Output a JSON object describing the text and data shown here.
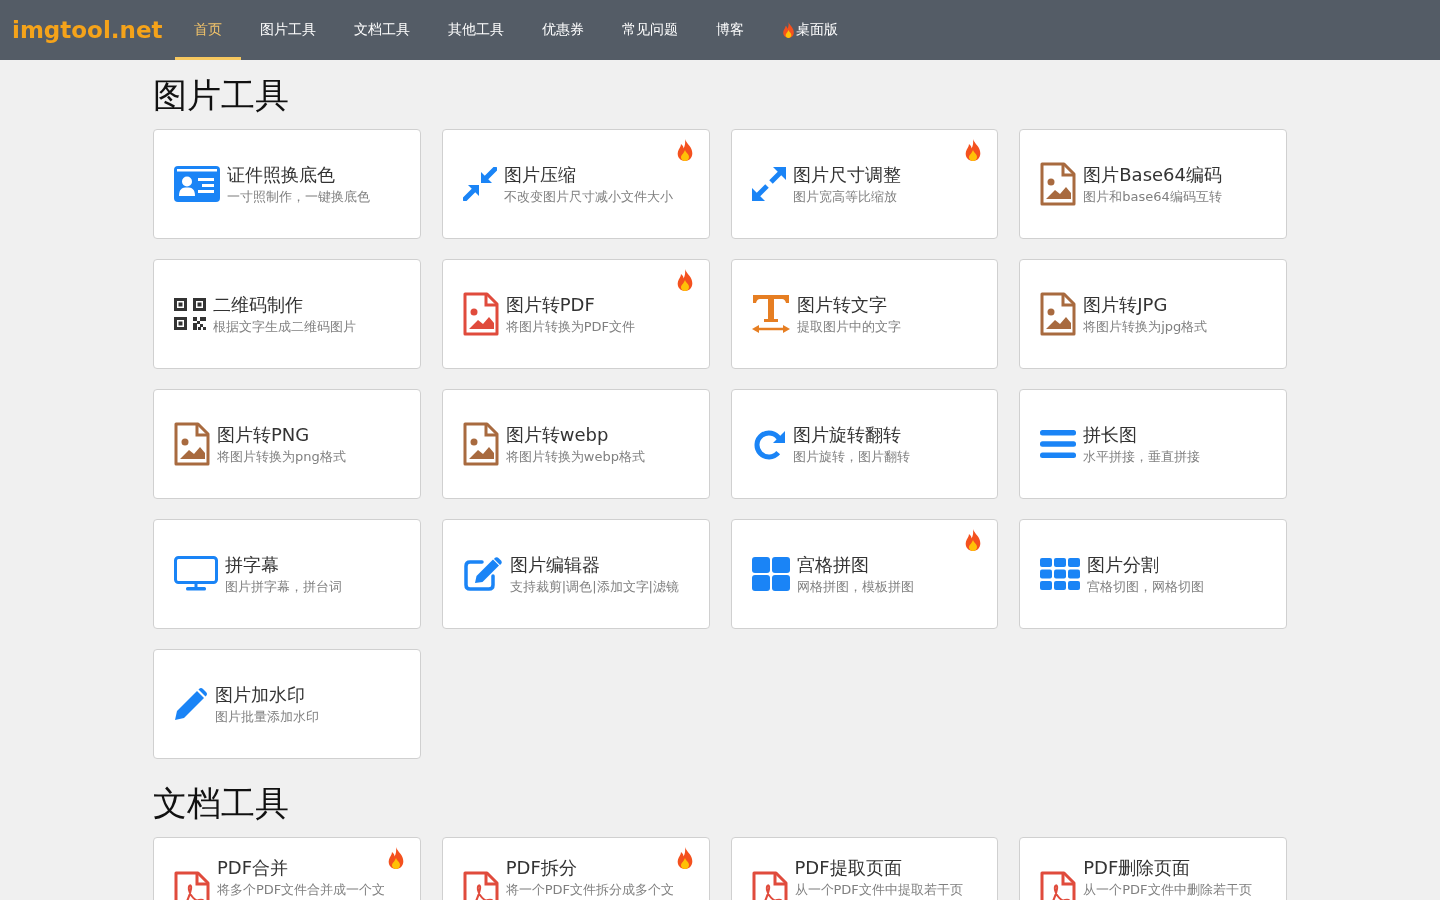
{
  "header": {
    "logo": "imgtool.net",
    "nav": [
      {
        "label": "首页",
        "selected": true,
        "hot": false
      },
      {
        "label": "图片工具",
        "selected": false,
        "hot": false
      },
      {
        "label": "文档工具",
        "selected": false,
        "hot": false
      },
      {
        "label": "其他工具",
        "selected": false,
        "hot": false
      },
      {
        "label": "优惠券",
        "selected": false,
        "hot": false
      },
      {
        "label": "常见问题",
        "selected": false,
        "hot": false
      },
      {
        "label": "博客",
        "selected": false,
        "hot": false
      },
      {
        "label": "桌面版",
        "selected": false,
        "hot": true
      }
    ]
  },
  "sections": [
    {
      "title": "图片工具",
      "tools": [
        {
          "kind": "idcard",
          "title": "证件照换底色",
          "description": "一寸照制作，一键换底色",
          "hot": false
        },
        {
          "kind": "compress",
          "title": "图片压缩",
          "description": "不改变图片尺寸减小文件大小",
          "hot": true
        },
        {
          "kind": "resize",
          "title": "图片尺寸调整",
          "description": "图片宽高等比缩放",
          "hot": true
        },
        {
          "kind": "image",
          "title": "图片Base64编码",
          "description": "图片和base64编码互转",
          "hot": false
        },
        {
          "kind": "qrcode",
          "title": "二维码制作",
          "description": "根据文字生成二维码图片",
          "hot": false
        },
        {
          "kind": "topdf",
          "title": "图片转PDF",
          "description": "将图片转换为PDF文件",
          "hot": true
        },
        {
          "kind": "text",
          "title": "图片转文字",
          "description": "提取图片中的文字",
          "hot": false
        },
        {
          "kind": "image",
          "title": "图片转JPG",
          "description": "将图片转换为jpg格式",
          "hot": false
        },
        {
          "kind": "image",
          "title": "图片转PNG",
          "description": "将图片转换为png格式",
          "hot": false
        },
        {
          "kind": "image",
          "title": "图片转webp",
          "description": "将图片转换为webp格式",
          "hot": false
        },
        {
          "kind": "rotate",
          "title": "图片旋转翻转",
          "description": "图片旋转，图片翻转",
          "hot": false
        },
        {
          "kind": "stack",
          "title": "拼长图",
          "description": "水平拼接，垂直拼接",
          "hot": false
        },
        {
          "kind": "monitor",
          "title": "拼字幕",
          "description": "图片拼字幕，拼台词",
          "hot": false
        },
        {
          "kind": "editor",
          "title": "图片编辑器",
          "description": "支持裁剪|调色|添加文字|滤镜",
          "hot": false
        },
        {
          "kind": "grid",
          "title": "宫格拼图",
          "description": "网格拼图，模板拼图",
          "hot": true
        },
        {
          "kind": "split",
          "title": "图片分割",
          "description": "宫格切图，网格切图",
          "hot": false
        },
        {
          "kind": "watermark",
          "title": "图片加水印",
          "description": "图片批量添加水印",
          "hot": false
        }
      ]
    },
    {
      "title": "文档工具",
      "tools": [
        {
          "kind": "pdf",
          "title": "PDF合并",
          "description": "将多个PDF文件合并成一个文",
          "hot": true
        },
        {
          "kind": "pdf",
          "title": "PDF拆分",
          "description": "将一个PDF文件拆分成多个文",
          "hot": true
        },
        {
          "kind": "pdf",
          "title": "PDF提取页面",
          "description": "从一个PDF文件中提取若干页",
          "hot": false
        },
        {
          "kind": "pdf",
          "title": "PDF删除页面",
          "description": "从一个PDF文件中删除若干页",
          "hot": false
        }
      ]
    }
  ]
}
